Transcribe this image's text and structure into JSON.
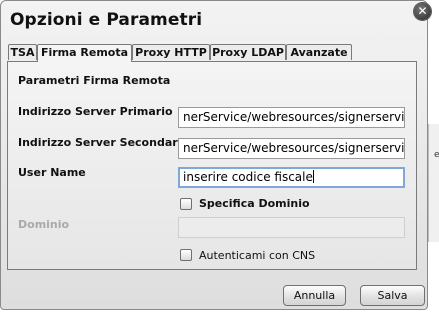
{
  "dialog": {
    "title": "Opzioni e Parametri",
    "close_icon": "close-icon"
  },
  "tabs": [
    {
      "label": "TSA",
      "active": false
    },
    {
      "label": "Firma Remota",
      "active": true
    },
    {
      "label": "Proxy HTTP",
      "active": false
    },
    {
      "label": "Proxy LDAP",
      "active": false
    },
    {
      "label": "Avanzate",
      "active": false
    }
  ],
  "panel": {
    "section_title": "Parametri Firma Remota",
    "primary_server_label": "Indirizzo Server Primario",
    "primary_server_value": "nerService/webresources/signerservice",
    "secondary_server_label": "Indirizzo Server Secondario",
    "secondary_server_value": "nerService/webresources/signerservice",
    "username_label": "User Name",
    "username_value": "inserire codice fiscale",
    "specify_domain_label": "Specifica Dominio",
    "specify_domain_checked": false,
    "domain_label": "Dominio",
    "domain_value": "",
    "cns_auth_label": "Autenticami con CNS",
    "cns_auth_checked": false
  },
  "buttons": {
    "cancel_label": "Annulla",
    "save_label": "Salva"
  },
  "background": {
    "fragment_text": "e"
  },
  "colors": {
    "focus_border": "#7fa7d8",
    "disabled_text": "#a9a9a9"
  }
}
